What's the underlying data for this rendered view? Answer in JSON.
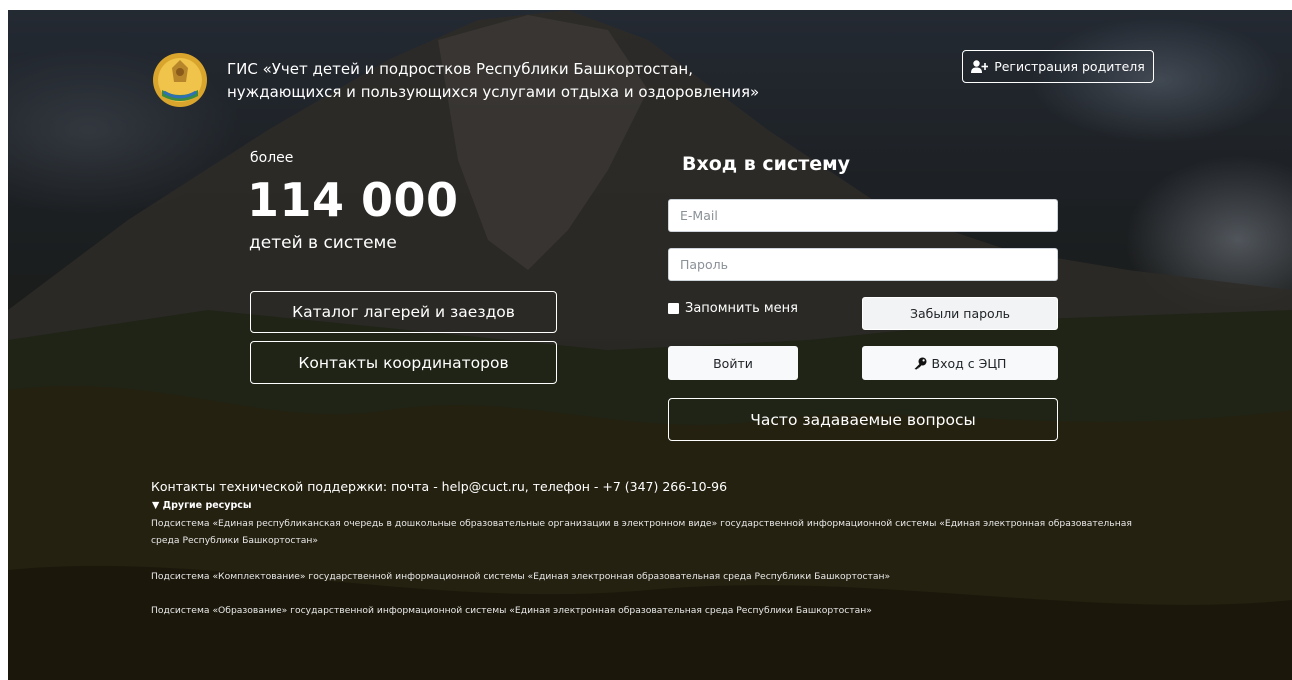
{
  "header": {
    "title_line1": "ГИС «Учет детей и подростков Республики Башкортостан,",
    "title_line2": "нуждающихся и пользующихся услугами отдыха и оздоровления»",
    "register_button": "Регистрация родителя"
  },
  "stats": {
    "prefix": "более",
    "count": "114 000",
    "label": "детей в системе"
  },
  "left_buttons": {
    "catalog": "Каталог лагерей и заездов",
    "contacts": "Контакты координаторов"
  },
  "login": {
    "title": "Вход в систему",
    "email_placeholder": "E-Mail",
    "password_placeholder": "Пароль",
    "remember_label": "Запомнить меня",
    "forgot_button": "Забыли пароль",
    "login_button": "Войти",
    "eds_button": "Вход с ЭЦП",
    "faq_button": "Часто задаваемые вопросы"
  },
  "footer": {
    "support": "Контакты технической поддержки: почта - help@cuct.ru, телефон - +7 (347) 266-10-96",
    "other_resources_label": "▼ Другие ресурсы",
    "resources": [
      "Подсистема «Единая республиканская очередь в дошкольные образовательные организации в электронном виде» государственной информационной системы «Единая электронная образовательная среда Республики Башкортостан»",
      "Подсистема «Комплектование» государственной информационной системы «Единая электронная образовательная среда Республики Башкортостан»",
      "Подсистема «Образование» государственной информационной системы «Единая электронная образовательная среда Республики Башкортостан»"
    ]
  },
  "icons": {
    "emblem": "bashkortostan-emblem-icon",
    "register": "user-plus-icon",
    "eds": "key-icon"
  },
  "colors": {
    "text": "#ffffff",
    "light_button": "#f8f9fa",
    "emblem_gold": "#e0b33a",
    "emblem_green": "#3a8a3f"
  }
}
